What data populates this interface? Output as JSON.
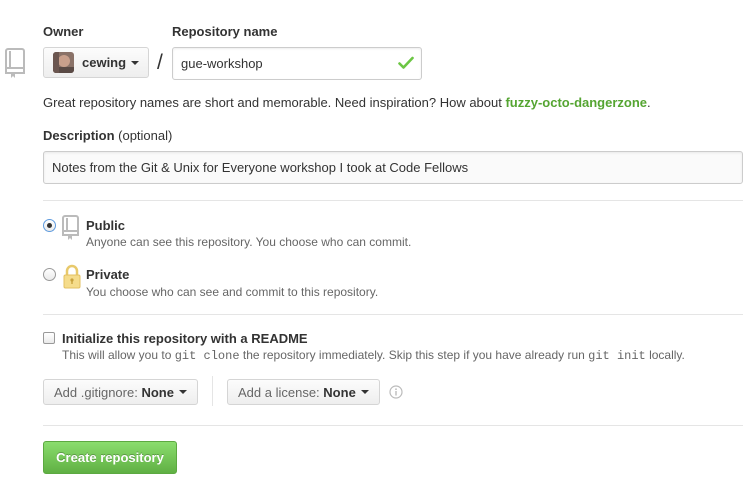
{
  "form": {
    "owner_label": "Owner",
    "owner_name": "cewing",
    "repo_name_label": "Repository name",
    "separator": "/",
    "repo_name_value": "gue-workshop",
    "hint_text": "Great repository names are short and memorable. Need inspiration? How about ",
    "hint_suggestion": "fuzzy-octo-dangerzone",
    "hint_end": ".",
    "description_label": "Description",
    "description_optional": "(optional)",
    "description_value": "Notes from the Git & Unix for Everyone workshop I took at Code Fellows"
  },
  "visibility": {
    "selected": "public",
    "public_title": "Public",
    "public_note": "Anyone can see this repository. You choose who can commit.",
    "private_title": "Private",
    "private_note": "You choose who can see and commit to this repository."
  },
  "init": {
    "checked": false,
    "label": "Initialize this repository with a README",
    "note_1": "This will allow you to ",
    "note_code_1": "git clone",
    "note_2": " the repository immediately. Skip this step if you have already run ",
    "note_code_2": "git init",
    "note_3": " locally."
  },
  "gitignore": {
    "label": "Add .gitignore:",
    "value": "None"
  },
  "license": {
    "label": "Add a license:",
    "value": "None"
  },
  "submit_label": "Create repository",
  "colors": {
    "accent_green": "#55a532",
    "button_green": "#60b044",
    "check_green": "#6cc644",
    "radio_focus": "#5f9bde"
  }
}
